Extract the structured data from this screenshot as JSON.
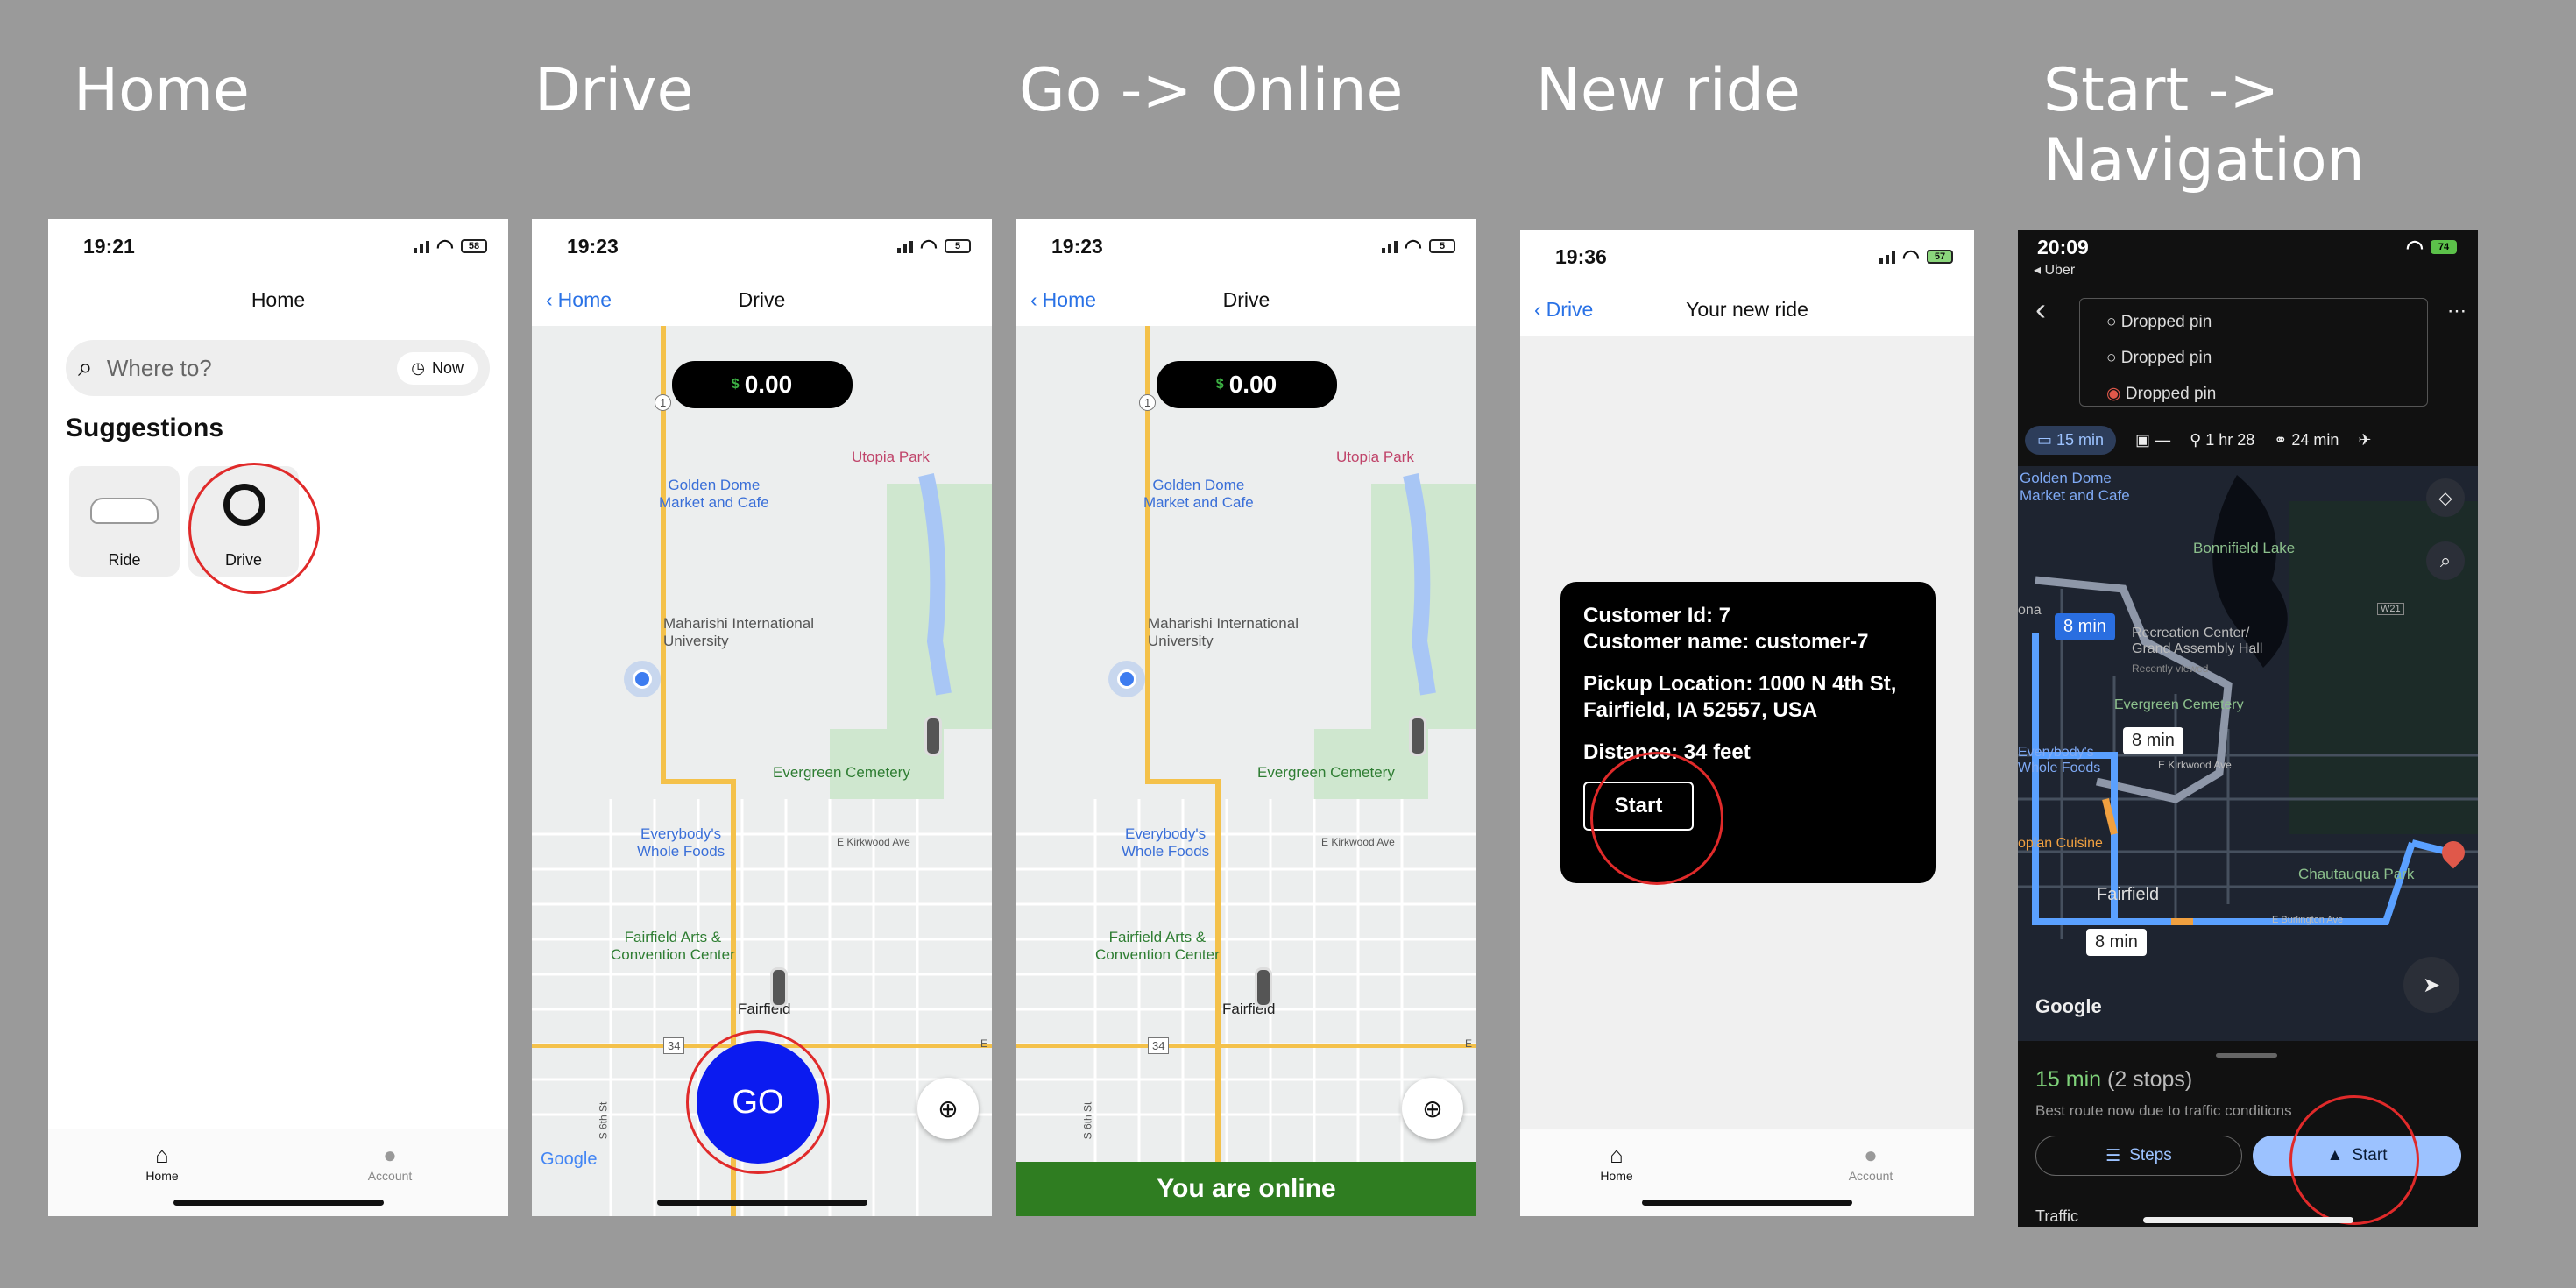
{
  "captions": [
    "Home",
    "Drive",
    "Go -> Online",
    "New ride",
    "Start ->\nNavigation"
  ],
  "home": {
    "time": "19:21",
    "battery": "58",
    "title": "Home",
    "search_placeholder": "Where to?",
    "now_label": "Now",
    "suggestions_title": "Suggestions",
    "suggestion_ride": "Ride",
    "suggestion_drive": "Drive",
    "tab_home": "Home",
    "tab_account": "Account"
  },
  "drive": {
    "time": "19:23",
    "battery": "5",
    "back": "Home",
    "title": "Drive",
    "dollar": "$",
    "amount": "0.00",
    "go": "GO",
    "places": {
      "utopia": "Utopia Park",
      "golden": "Golden Dome\nMarket and Cafe",
      "mum": "Maharishi International\nUniversity",
      "evergreen": "Evergreen Cemetery",
      "everybody": "Everybody's\nWhole Foods",
      "kirkwood": "E Kirkwood Ave",
      "arts": "Fairfield Arts &\nConvention Center",
      "fairfield": "Fairfield",
      "r1": "1",
      "r34": "34",
      "r6th": "S 6th St",
      "google": "Google",
      "e": "E"
    }
  },
  "online": {
    "time": "19:23",
    "battery": "5",
    "back": "Home",
    "title": "Drive",
    "dollar": "$",
    "amount": "0.00",
    "banner": "You are online"
  },
  "newride": {
    "time": "19:36",
    "battery": "57",
    "back": "Drive",
    "title": "Your new ride",
    "customer_id": "Customer Id: 7",
    "customer_name": "Customer name: customer-7",
    "pickup": "Pickup Location: 1000 N 4th St, Fairfield, IA 52557, USA",
    "distance": "Distance: 34 feet",
    "start": "Start",
    "tab_home": "Home",
    "tab_account": "Account"
  },
  "nav": {
    "time": "20:09",
    "battery": "74",
    "back_app": "◂ Uber",
    "stops": [
      "Dropped pin",
      "Dropped pin",
      "Dropped pin"
    ],
    "mode_car": "15 min",
    "mode_transit": "—",
    "mode_walk": "1 hr 28",
    "mode_bike": "24 min",
    "eta1": "8 min",
    "eta2": "8 min",
    "eta3": "8 min",
    "places": {
      "golden": "Golden Dome\nMarket and Cafe",
      "bonnifield": "Bonnifield Lake",
      "rec": "Recreation Center/\nGrand Assembly Hall",
      "recent": "Recently viewed",
      "evergreen": "Evergreen Cemetery",
      "everybody": "Everybody's\nWhole Foods",
      "kirkwood": "E Kirkwood Ave",
      "cuisine": "opian Cuisine",
      "chautauqua": "Chautauqua Park",
      "fairfield": "Fairfield",
      "burlington": "E Burlington Ave",
      "ona": "ona",
      "w21": "W21",
      "google": "Google"
    },
    "summary_time": "15 min",
    "summary_stops": "(2 stops)",
    "summary_note": "Best route now due to traffic conditions",
    "steps": "Steps",
    "start": "Start",
    "traffic": "Traffic"
  },
  "colors": {
    "accent": "#2a72e6",
    "go_blue": "#0b1bf0",
    "ring_red": "#e02a2a",
    "online_green": "#2f7d21",
    "route_blue": "#5aa0ff"
  }
}
